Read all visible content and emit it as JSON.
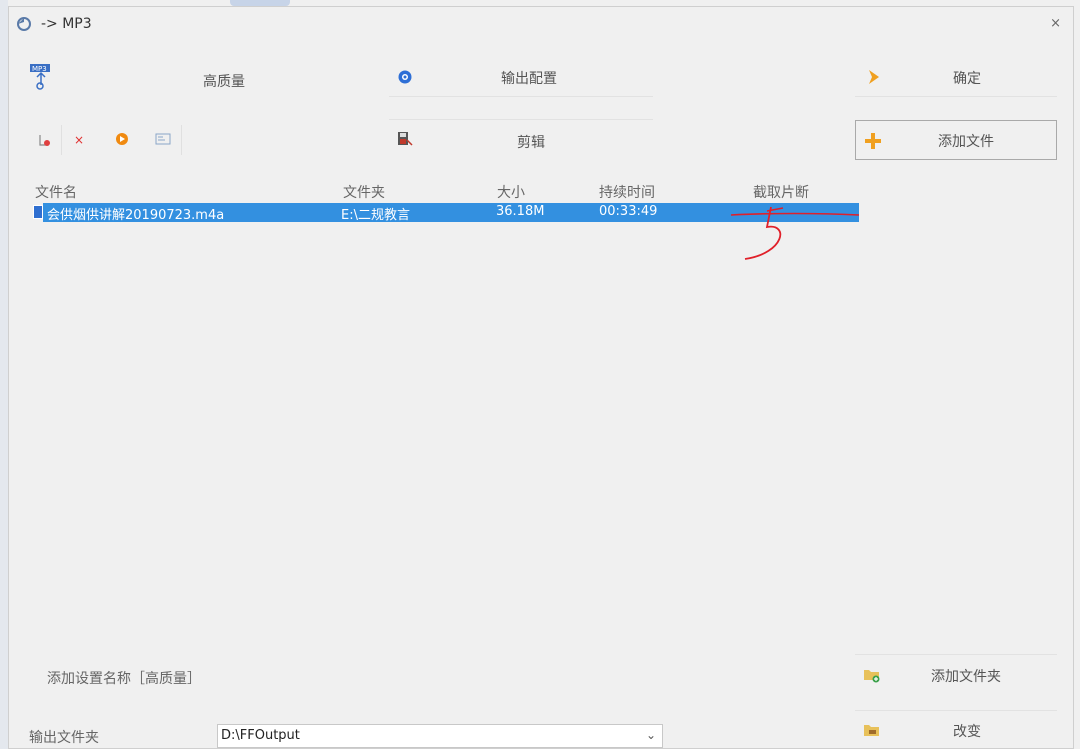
{
  "window": {
    "title": "-> MP3",
    "close_label": "×"
  },
  "toolbar": {
    "quality_label": "高质量",
    "output_config_label": "输出配置",
    "ok_label": "确定",
    "clip_label": "剪辑",
    "add_file_label": "添加文件"
  },
  "icons": {
    "app": "convert-icon",
    "mp3": "mp3-icon",
    "output_config": "gear-icon",
    "ok": "arrow-right-icon",
    "clip": "scissors-icon",
    "add": "plus-icon",
    "small_tools": [
      "remove-icon",
      "delete-icon",
      "play-icon",
      "info-icon"
    ],
    "add_folder": "folder-add-icon",
    "change": "folder-open-icon"
  },
  "file_list": {
    "columns": [
      "文件名",
      "文件夹",
      "大小",
      "持续时间",
      "截取片断"
    ],
    "rows": [
      {
        "name": "会供烟供讲解20190723.m4a",
        "folder": "E:\\二规教言",
        "size": "36.18M",
        "duration": "00:33:49",
        "clip": ""
      }
    ]
  },
  "annotation": {
    "color": "#e0202a"
  },
  "bottom": {
    "add_setting_label": "添加设置名称［高质量］",
    "add_folder_label": "添加文件夹",
    "output_folder_label": "输出文件夹",
    "output_folder_value": "D:\\FFOutput",
    "change_label": "改变"
  },
  "colors": {
    "selection": "#3390e0",
    "accent_orange": "#f0a020"
  }
}
